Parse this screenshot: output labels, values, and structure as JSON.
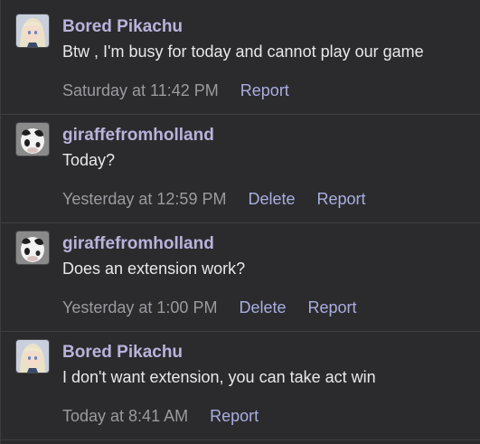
{
  "messages": [
    {
      "avatar": "anime-girl-avatar",
      "username": "Bored Pikachu",
      "text": "Btw , I'm busy for today and cannot play our game",
      "time": "Saturday at 11:42 PM",
      "actions": [
        "Report"
      ]
    },
    {
      "avatar": "cow-avatar",
      "username": "giraffefromholland",
      "text": "Today?",
      "time": "Yesterday at 12:59 PM",
      "actions": [
        "Delete",
        "Report"
      ]
    },
    {
      "avatar": "cow-avatar",
      "username": "giraffefromholland",
      "text": "Does an extension work?",
      "time": "Yesterday at 1:00 PM",
      "actions": [
        "Delete",
        "Report"
      ]
    },
    {
      "avatar": "anime-girl-avatar",
      "username": "Bored Pikachu",
      "text": "I don't want extension, you can take act win",
      "time": "Today at 8:41 AM",
      "actions": [
        "Report"
      ]
    }
  ],
  "colors": {
    "background": "#2b2b2d",
    "username": "#b9b3dc",
    "text": "#e8e8ea",
    "time": "#9a9aa0",
    "action": "#a9aee0",
    "divider": "#3f3f43"
  }
}
